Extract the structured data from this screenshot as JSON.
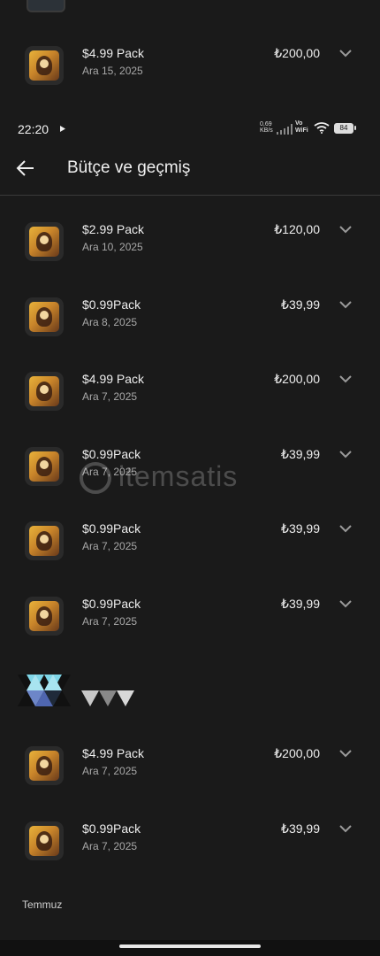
{
  "status_bar": {
    "time": "22:20",
    "net_speed_value": "0,69",
    "net_speed_unit": "KB/s",
    "carrier_top": "Vo",
    "carrier_bottom": "WiFi",
    "battery": "84"
  },
  "header": {
    "title": "Bütçe ve geçmiş"
  },
  "top_item": {
    "title": "$4.99 Pack",
    "date": "Ara 15, 2025",
    "price": "₺200,00"
  },
  "items": [
    {
      "title": "$2.99 Pack",
      "date": "Ara 10, 2025",
      "price": "₺120,00"
    },
    {
      "title": "$0.99Pack",
      "date": "Ara 8, 2025",
      "price": "₺39,99"
    },
    {
      "title": "$4.99 Pack",
      "date": "Ara 7, 2025",
      "price": "₺200,00"
    },
    {
      "title": "$0.99Pack",
      "date": "Ara 7, 2025",
      "price": "₺39,99"
    },
    {
      "title": "$0.99Pack",
      "date": "Ara 7, 2025",
      "price": "₺39,99"
    },
    {
      "title": "$0.99Pack",
      "date": "Ara 7, 2025",
      "price": "₺39,99"
    },
    {
      "title": "$4.99 Pack",
      "date": "Ara 7, 2025",
      "price": "₺200,00"
    },
    {
      "title": "$0.99Pack",
      "date": "Ara 7, 2025",
      "price": "₺39,99"
    }
  ],
  "watermark": {
    "text": "itemsatis"
  },
  "section_label": "Temmuz",
  "icons": {
    "back": "arrow-left-icon",
    "expand": "chevron-down-icon",
    "wifi": "wifi-icon",
    "signal": "signal-icon",
    "play": "play-icon"
  },
  "colors": {
    "background": "#1a1a1a",
    "text_primary": "#ededed",
    "text_secondary": "#a8a8a8",
    "divider": "#3a3a3a"
  }
}
